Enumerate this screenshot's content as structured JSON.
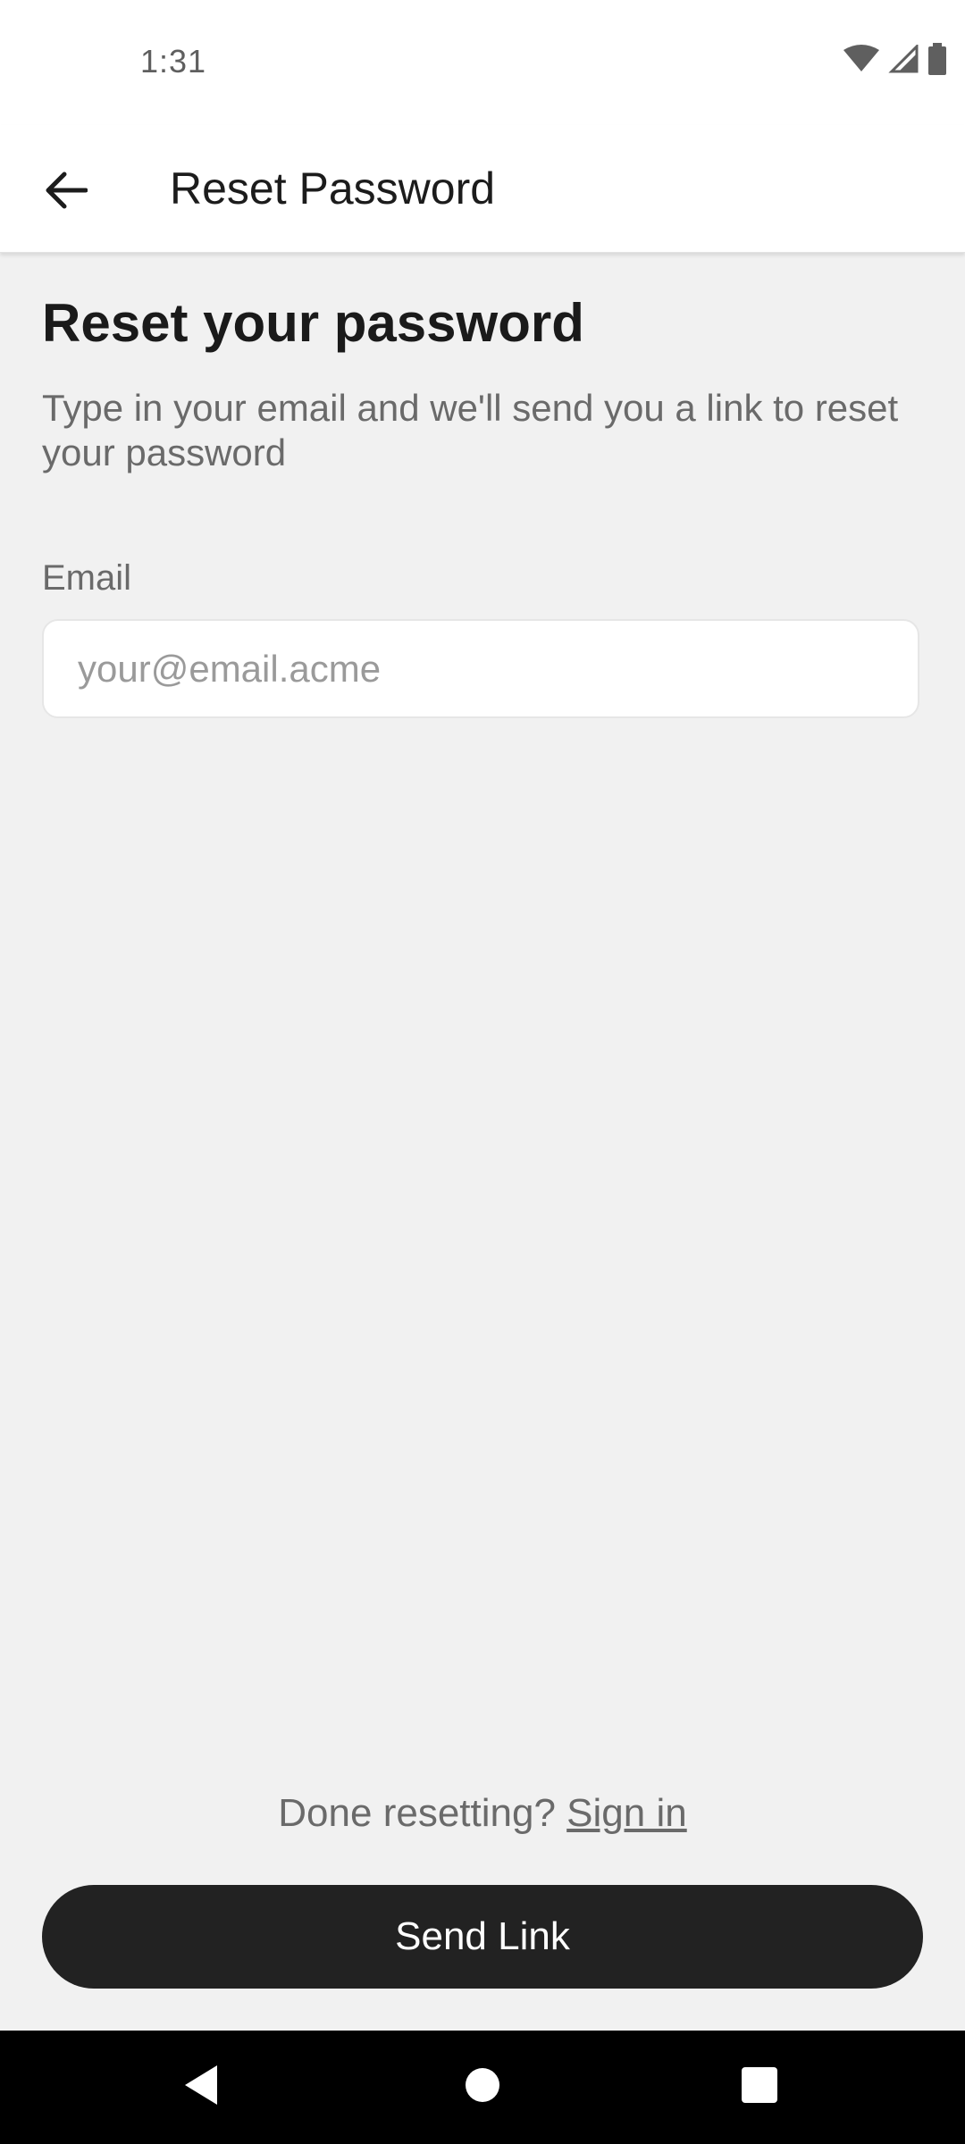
{
  "status_bar": {
    "time": "1:31",
    "icons": [
      "wifi-icon",
      "signal-icon",
      "battery-icon"
    ]
  },
  "app_bar": {
    "back_icon": "arrow-left-icon",
    "title": "Reset Password"
  },
  "main": {
    "heading": "Reset your password",
    "subtitle": "Type in your email and we'll send you a link to reset your password",
    "email_label": "Email",
    "email_placeholder": "your@email.acme",
    "email_value": ""
  },
  "footer": {
    "prompt": "Done resetting?",
    "signin_link": "Sign in",
    "send_button": "Send Link"
  },
  "nav_bar": {
    "icons": [
      "back-triangle-icon",
      "home-circle-icon",
      "recents-square-icon"
    ]
  },
  "colors": {
    "background": "#f1f1f1",
    "button": "#222222",
    "button_text": "#ffffff",
    "muted_text": "#6a6a6a"
  }
}
